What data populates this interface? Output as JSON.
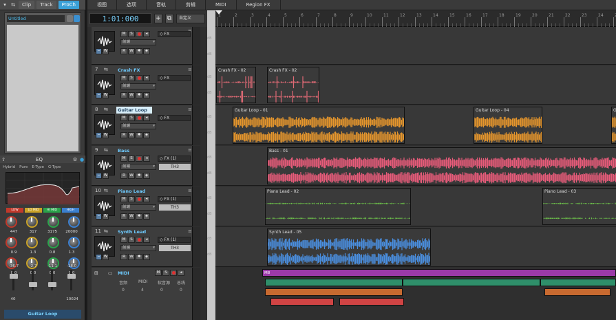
{
  "inspector": {
    "tabs": [
      {
        "label": "Clip",
        "active": false
      },
      {
        "label": "Track",
        "active": false
      },
      {
        "label": "ProCh",
        "active": true
      }
    ],
    "preset_name": "Untitled",
    "eq": {
      "title": "EQ",
      "modes": [
        "Hybrid",
        "Pure",
        "E-Type",
        "G-Type"
      ],
      "band_labels": [
        "LOW",
        "LO MID",
        "HI MID",
        "HIGH"
      ],
      "band_colors": [
        "#c0392b",
        "#c9a227",
        "#2aa34a",
        "#3a7fd0"
      ],
      "freq_values": [
        "447",
        "317",
        "3175",
        "20000"
      ],
      "q_values": [
        "0.9",
        "1.3",
        "0.8",
        "1.3"
      ],
      "gain_values": [
        "0.0",
        "0.0",
        "0.0",
        "0.0"
      ],
      "fader_values": [
        "-36.7",
        "-2.7",
        "-11.1",
        "-18.0"
      ],
      "bottom_values": [
        "40",
        "10024"
      ]
    },
    "track_name": "Guitar Loop"
  },
  "menubar": [
    "视图",
    "选项",
    "音轨",
    "剪辑",
    "MIDI",
    "Region FX"
  ],
  "transport": {
    "time": "1:01:000",
    "add_label": "+",
    "snap_label": "自定义"
  },
  "ruler": {
    "labels": [
      "1",
      "2",
      "3",
      "4",
      "5",
      "6",
      "7",
      "8",
      "9",
      "10",
      "11",
      "12",
      "13",
      "14",
      "15",
      "16",
      "17",
      "18",
      "19",
      "20",
      "21",
      "22",
      "23",
      "24",
      "25"
    ]
  },
  "db_label": "dB",
  "tracks": [
    {
      "num": "",
      "name": "",
      "fx": "FX",
      "plugin": "",
      "dd": "前端",
      "clips": []
    },
    {
      "num": "7",
      "name": "Crash FX",
      "fx": "FX",
      "plugin": "",
      "dd": "前端",
      "selected": false,
      "clips": [
        {
          "label": "Crash FX - 02",
          "color": "#e06a75"
        },
        {
          "label": "Crash FX - 02",
          "color": "#e06a75"
        }
      ]
    },
    {
      "num": "8",
      "name": "Guitar Loop",
      "fx": "FX",
      "plugin": "",
      "dd": "前端",
      "selected": true,
      "clips": [
        {
          "label": "Guitar Loop - 01",
          "color": "#e6962c"
        },
        {
          "label": "Guitar Loop - 04",
          "color": "#e6962c"
        },
        {
          "label": "G",
          "color": "#e6962c"
        }
      ]
    },
    {
      "num": "9",
      "name": "Bass",
      "fx": "FX (1)",
      "plugin": "TH3",
      "dd": "前端",
      "selected": false,
      "clips": [
        {
          "label": "Bass - 01",
          "color": "#e85b7a"
        }
      ]
    },
    {
      "num": "10",
      "name": "Piano Lead",
      "fx": "FX (1)",
      "plugin": "TH3",
      "dd": "前端",
      "selected": false,
      "clips": [
        {
          "label": "Piano Lead - 02",
          "color": "#6cc04a"
        },
        {
          "label": "Piano Lead - 03",
          "color": "#6cc04a"
        }
      ]
    },
    {
      "num": "11",
      "name": "Synth Lead",
      "fx": "FX (1)",
      "plugin": "TH3",
      "dd": "前端",
      "selected": false,
      "clips": [
        {
          "label": "Synth Lead - 05",
          "color": "#4a8fe0"
        }
      ]
    }
  ],
  "midi": {
    "name": "MIDI",
    "col_labels": [
      "音频",
      "MIDI",
      "软音源",
      "总线"
    ],
    "col_values": [
      "0",
      "4",
      "0",
      "0"
    ],
    "clip_label": "M8",
    "colors": [
      "#9b3aa8",
      "#2f8f6a",
      "#c86a30",
      "#d04444"
    ]
  }
}
